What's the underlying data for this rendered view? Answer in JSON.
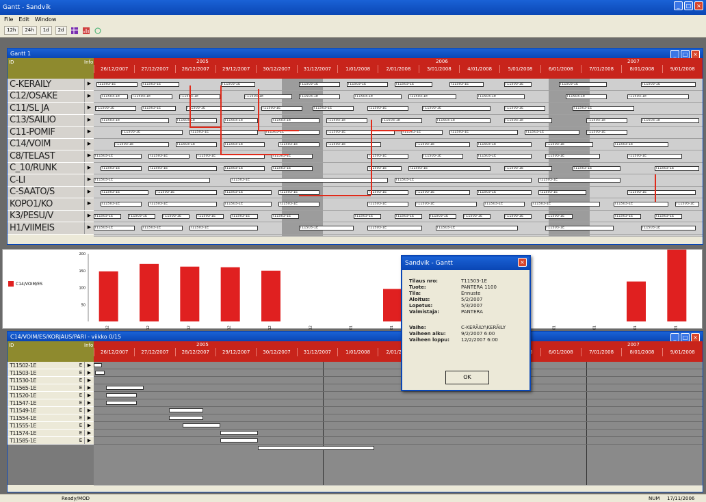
{
  "app": {
    "title": "Gantt - Sandvik"
  },
  "menu": [
    "File",
    "Edit",
    "Window"
  ],
  "toolbar": {
    "buttons": [
      "12h",
      "24h",
      "1d",
      "2d"
    ]
  },
  "top_window": {
    "title": "Gantt 1",
    "corner_top": "ID",
    "corner_right": "Info",
    "years": [
      "2005",
      "2006",
      "2007"
    ],
    "days": [
      "26/12/2007",
      "27/12/2007",
      "28/12/2007",
      "29/12/2007",
      "30/12/2007",
      "31/12/2007",
      "1/01/2008",
      "2/01/2008",
      "3/01/2008",
      "4/01/2008",
      "5/01/2008",
      "6/01/2008",
      "7/01/2008",
      "8/01/2008",
      "9/01/2008"
    ],
    "rows": [
      "C-KERÄILY",
      "C12/OSAKE",
      "C11/SL JA",
      "C13/SÄILIÖ",
      "C11-POMIF",
      "C14/VOIM",
      "C8/TELAST",
      "C_10/RUNK",
      "C-LI",
      "C-SÄÄTÖ/S",
      "KOPO1/KO",
      "K3/PESU/V",
      "H1/VIIMEIS"
    ],
    "task_label": "T11503-1E"
  },
  "chart": {
    "legend": "C14/VOIM/ES",
    "y_ticks": [
      "200",
      "150",
      "100",
      "50"
    ],
    "x_labels": [
      "26/12",
      "27/12",
      "28/12",
      "29/12",
      "30/12",
      "31/12",
      "1/01",
      "2/01",
      "3/01",
      "4/01",
      "5/01",
      "6/01",
      "7/01",
      "8/01",
      "9/01"
    ]
  },
  "chart_data": {
    "type": "bar",
    "categories": [
      "26/12",
      "27/12",
      "28/12",
      "29/12",
      "30/12",
      "31/12",
      "1/01",
      "2/01",
      "3/01",
      "4/01",
      "5/01",
      "6/01",
      "7/01",
      "8/01",
      "9/01"
    ],
    "values": [
      148,
      170,
      162,
      160,
      150,
      0,
      0,
      96,
      0,
      0,
      0,
      0,
      0,
      118,
      222
    ],
    "ylim": [
      0,
      200
    ],
    "color": "#e02020"
  },
  "bottom_window": {
    "title": "C14/VOIM/ES/KORJAUS/PARI - viikko 0/15",
    "corner_top": "ID",
    "corner_right": "Info",
    "rows": [
      "T11502-1E",
      "T11503-1E",
      "T11530-1E",
      "T11565-1E",
      "T11520-1E",
      "T11547-1E",
      "T11549-1E",
      "T11554-1E",
      "T11555-1E",
      "T11574-1E",
      "T11585-1E"
    ],
    "row_flag": "E"
  },
  "dialog": {
    "title": "Sandvik - Gantt",
    "fields": [
      {
        "label": "Tilaus nro:",
        "value": "T11503-1E"
      },
      {
        "label": "Tuote:",
        "value": "PANTERA 1100"
      },
      {
        "label": "Tila:",
        "value": "Ennuste"
      },
      {
        "label": "Aloitus:",
        "value": "5/2/2007"
      },
      {
        "label": "Lopetus:",
        "value": "5/3/2007"
      },
      {
        "label": "Valmistaja:",
        "value": "PANTERA"
      },
      {
        "label": "Vaihe:",
        "value": "C-KERÄILY\\KERÄILY"
      },
      {
        "label": "Vaiheen alku:",
        "value": "9/2/2007 6:00"
      },
      {
        "label": "Vaiheen loppu:",
        "value": "12/2/2007 6:00"
      }
    ],
    "ok": "OK"
  },
  "status": {
    "left": "Ready/MOD",
    "right1": "NUM",
    "right2": "17/11/2006"
  }
}
